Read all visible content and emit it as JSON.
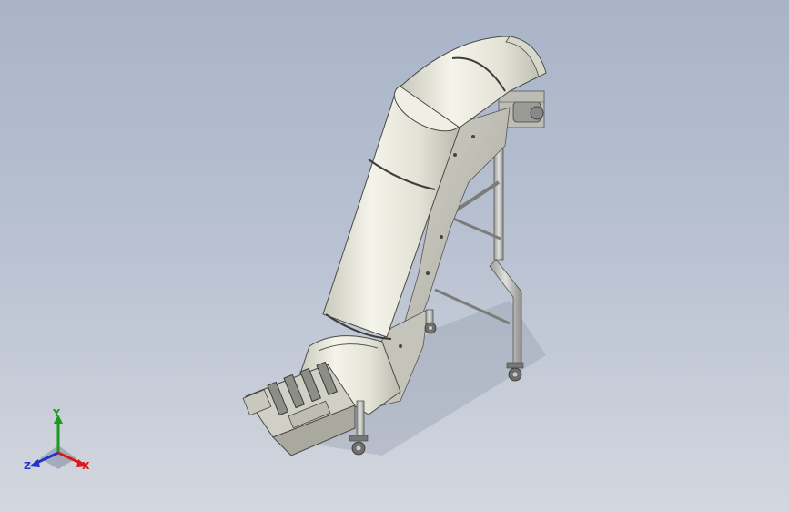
{
  "view": {
    "background_top": "#a9b4c8",
    "background_bottom": "#d3d7df"
  },
  "model": {
    "icon": "inclined-chain-conveyor-model",
    "shell_color": "#e8e8de",
    "frame_color": "#a0a0a0"
  },
  "triad": {
    "x_label": "X",
    "y_label": "Y",
    "z_label": "Z",
    "x_color": "#d81b1b",
    "y_color": "#1a9a1a",
    "z_color": "#2434c8"
  }
}
